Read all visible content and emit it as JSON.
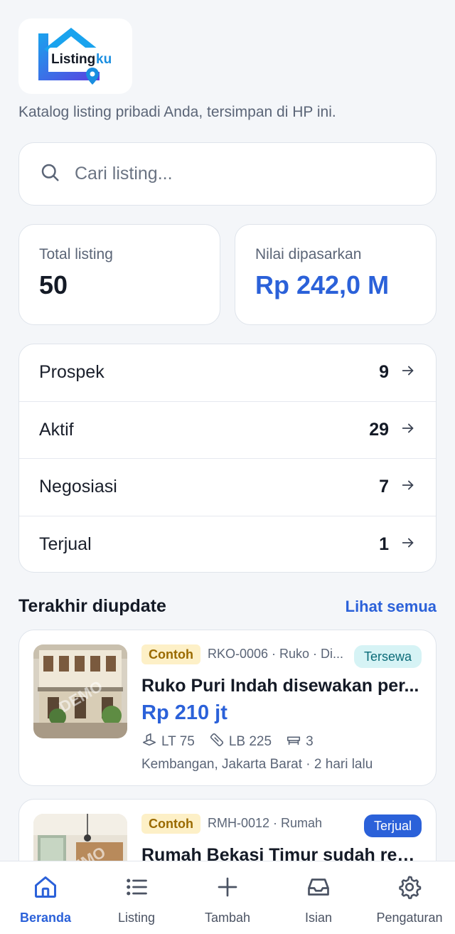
{
  "logo": {
    "text": "Listingku"
  },
  "tagline": "Katalog listing pribadi Anda, tersimpan di HP ini.",
  "search": {
    "placeholder": "Cari listing...",
    "value": ""
  },
  "stats": {
    "total": {
      "label": "Total listing",
      "value": "50"
    },
    "market": {
      "label": "Nilai dipasarkan",
      "value": "Rp 242,0 M"
    }
  },
  "pipeline": [
    {
      "label": "Prospek",
      "count": "9"
    },
    {
      "label": "Aktif",
      "count": "29"
    },
    {
      "label": "Negosiasi",
      "count": "7"
    },
    {
      "label": "Terjual",
      "count": "1"
    }
  ],
  "recent": {
    "title": "Terakhir diupdate",
    "see_all": "Lihat semua",
    "items": [
      {
        "badge": "Contoh",
        "meta": "RKO-0006 · Ruko · Di...",
        "status": "Tersewa",
        "title": "Ruko Puri Indah disewakan per...",
        "price": "Rp 210 jt",
        "lt": "LT 75",
        "lb": "LB 225",
        "floors": "3",
        "location": "Kembangan, Jakarta Barat · 2 hari lalu",
        "watermark": "DEMO"
      },
      {
        "badge": "Contoh",
        "meta": "RMH-0012 · Rumah",
        "status": "Terjual",
        "title": "Rumah Bekasi Timur sudah ren...",
        "watermark": "DEMO"
      }
    ]
  },
  "nav": [
    {
      "label": "Beranda",
      "icon": "home-icon",
      "active": true
    },
    {
      "label": "Listing",
      "icon": "list-icon"
    },
    {
      "label": "Tambah",
      "icon": "plus-icon"
    },
    {
      "label": "Isian",
      "icon": "inbox-icon"
    },
    {
      "label": "Pengaturan",
      "icon": "gear-icon"
    }
  ],
  "colors": {
    "accent": "#2b61d9",
    "background": "#f4f6f9",
    "rent_badge": "#d6f3f5",
    "demo_badge": "#fdf0c7"
  }
}
